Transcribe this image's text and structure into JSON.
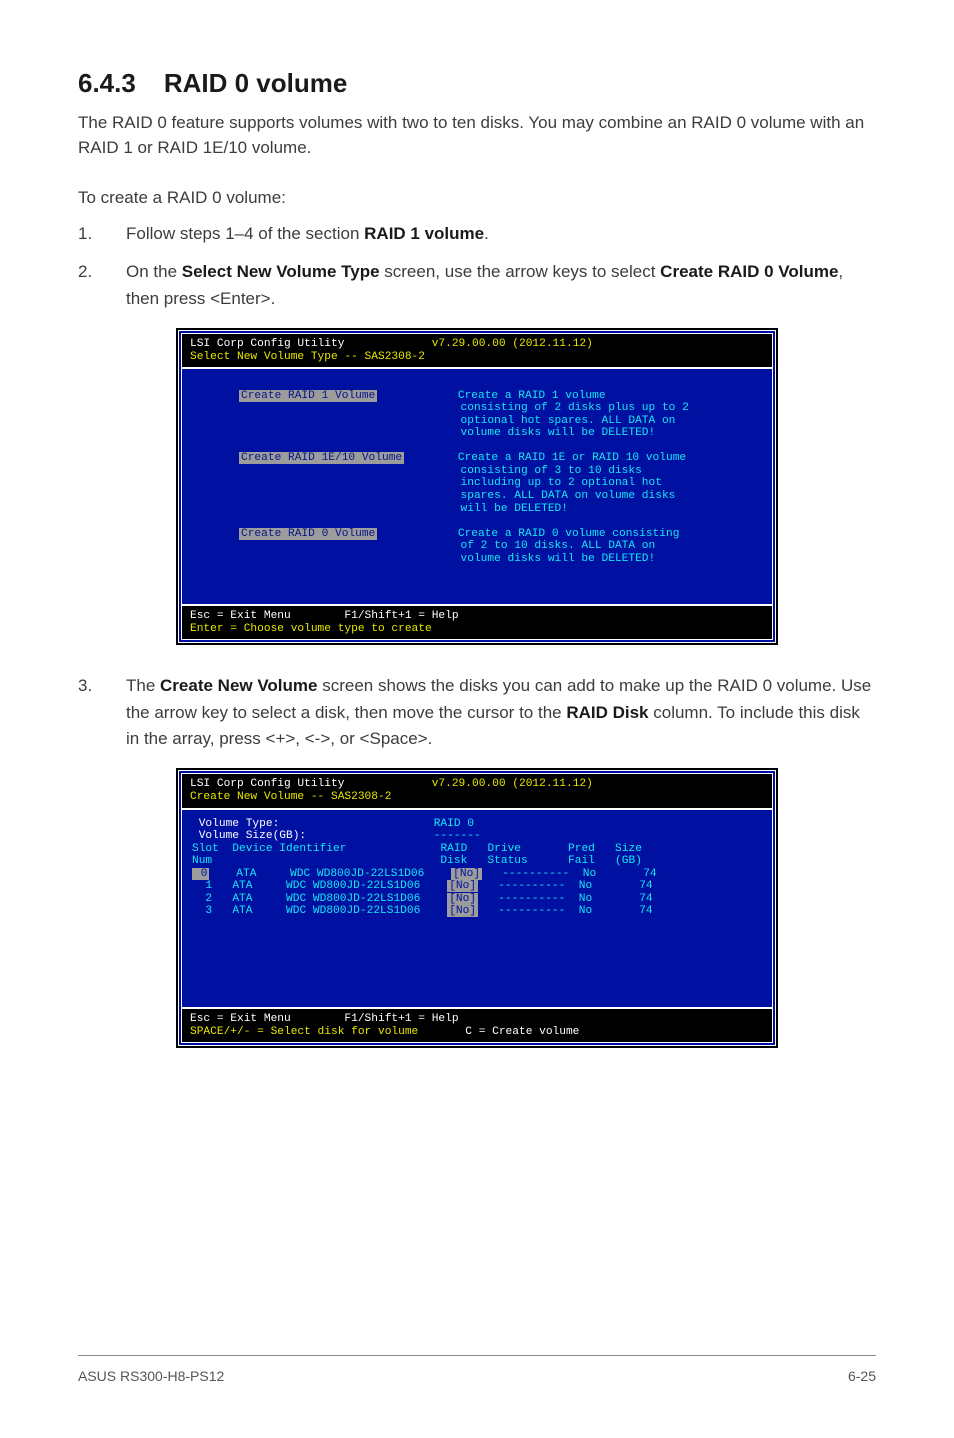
{
  "section": {
    "number": "6.4.3",
    "title": "RAID 0 volume"
  },
  "intro": "The RAID 0 feature supports volumes with two to ten disks. You may combine an RAID 0 volume with an RAID 1 or RAID 1E/10 volume.",
  "lead": "To create a RAID 0 volume:",
  "steps": {
    "1": {
      "num": "1.",
      "pre": "Follow steps 1–4 of the section ",
      "bold": "RAID 1 volume",
      "post": "."
    },
    "2": {
      "num": "2.",
      "p1": "On the ",
      "b1": "Select New Volume Type",
      "p2": " screen, use the arrow keys to select ",
      "b2": "Create RAID 0 Volume",
      "p3": ", then press <Enter>."
    },
    "3": {
      "num": "3.",
      "p1": "The ",
      "b1": "Create New Volume",
      "p2": " screen shows the disks you can add to make up the RAID 0 volume. Use the arrow key to select a disk, then move the cursor to the ",
      "b2": "RAID Disk",
      "p3": " column. To include this disk in the array, press <+>, <->, or <Space>."
    }
  },
  "bios1": {
    "hdr_l1a": "LSI Corp Config Utility",
    "hdr_l1b": "v7.29.00.00 (2012.11.12)",
    "hdr_l2": "Select New Volume Type -- SAS2308-2",
    "btn1": "Create RAID 1 Volume",
    "desc1": "Create a RAID 1 volume\nconsisting of 2 disks plus up to 2\noptional hot spares. ALL DATA on\nvolume disks will be DELETED!",
    "btn2": "Create RAID 1E/10 Volume",
    "desc2": "Create a RAID 1E or RAID 10 volume\nconsisting of 3 to 10 disks\nincluding up to 2 optional hot\nspares. ALL DATA on volume disks\nwill be DELETED!",
    "btn3": "Create RAID 0 Volume",
    "desc3": "Create a RAID 0 volume consisting\nof 2 to 10 disks. ALL DATA on\nvolume disks will be DELETED!",
    "ftr_l1": "Esc = Exit Menu        F1/Shift+1 = Help",
    "ftr_l2": "Enter = Choose volume type to create"
  },
  "bios2": {
    "hdr_l1a": "LSI Corp Config Utility",
    "hdr_l1b": "v7.29.00.00 (2012.11.12)",
    "hdr_l2": "Create New Volume -- SAS2308-2",
    "vol_type_lbl": "Volume Type:",
    "vol_type_val": "RAID 0",
    "vol_size_lbl": "Volume Size(GB):",
    "vol_size_val": "-------",
    "th_slot": "Slot",
    "th_dev": "Device Identifier",
    "th_raid": "RAID",
    "th_drive": "Drive",
    "th_pred": "Pred",
    "th_size": "Size",
    "th_num": "Num",
    "th_disk": "Disk",
    "th_status": "Status",
    "th_fail": "Fail",
    "th_gb": "(GB)",
    "rows": [
      {
        "slot": " 0",
        "vendor": "ATA",
        "model": "WDC WD800JD-22LS1D06",
        "raid": "[No]",
        "status": "----------",
        "pred": "No",
        "size": "74"
      },
      {
        "slot": " 1",
        "vendor": "ATA",
        "model": "WDC WD800JD-22LS1D06",
        "raid": "[No]",
        "status": "----------",
        "pred": "No",
        "size": "74"
      },
      {
        "slot": " 2",
        "vendor": "ATA",
        "model": "WDC WD800JD-22LS1D06",
        "raid": "[No]",
        "status": "----------",
        "pred": "No",
        "size": "74"
      },
      {
        "slot": " 3",
        "vendor": "ATA",
        "model": "WDC WD800JD-22LS1D06",
        "raid": "[No]",
        "status": "----------",
        "pred": "No",
        "size": "74"
      }
    ],
    "ftr_l1": "Esc = Exit Menu        F1/Shift+1 = Help",
    "ftr_l2a": "SPACE/+/- = Select disk for volume",
    "ftr_l2b": "C = Create volume"
  },
  "footer": {
    "left": "ASUS RS300-H8-PS12",
    "right": "6-25"
  }
}
